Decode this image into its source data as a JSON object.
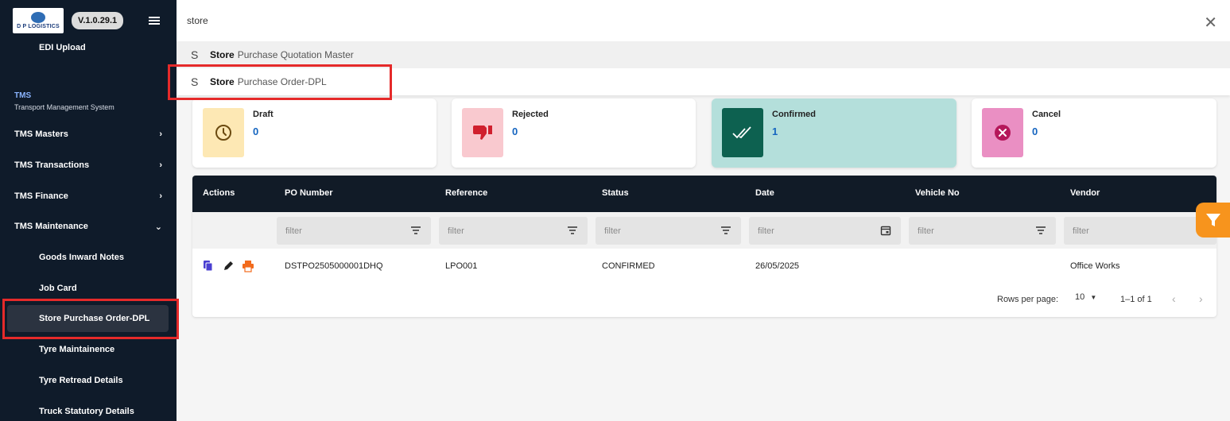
{
  "sidebar": {
    "logo_text": "D P LOGISTICS",
    "version": "V.1.0.29.1",
    "edi_upload": "EDI Upload",
    "section_title": "TMS",
    "section_subtitle": "Transport Management System",
    "items": [
      {
        "label": "TMS Masters",
        "chevron": "›"
      },
      {
        "label": "TMS Transactions",
        "chevron": "›"
      },
      {
        "label": "TMS Finance",
        "chevron": "›"
      },
      {
        "label": "TMS Maintenance",
        "chevron": "⌄"
      }
    ],
    "subitems": [
      {
        "label": "Goods Inward Notes"
      },
      {
        "label": "Job Card"
      },
      {
        "label": "Store Purchase Order-DPL",
        "active": true
      },
      {
        "label": "Tyre Maintainence"
      },
      {
        "label": "Tyre Retread Details"
      },
      {
        "label": "Truck Statutory Details"
      }
    ]
  },
  "search": {
    "value": "store",
    "close_icon": "✕",
    "results": [
      {
        "icon": "S",
        "highlight": "Store",
        "rest": "Purchase Quotation Master"
      },
      {
        "icon": "S",
        "highlight": "Store",
        "rest": "Purchase Order-DPL"
      }
    ]
  },
  "cards": [
    {
      "label": "Draft",
      "count": "0",
      "icon": "clock-icon",
      "icon_bg": "#fde8b4",
      "icon_color": "#b07a10"
    },
    {
      "label": "Rejected",
      "count": "0",
      "icon": "thumbs-down-icon",
      "icon_bg": "#f9c9cf",
      "icon_color": "#d0202e"
    },
    {
      "label": "Confirmed",
      "count": "1",
      "icon": "double-check-icon",
      "icon_bg": "#0d6150",
      "icon_color": "#ffffff"
    },
    {
      "label": "Cancel",
      "count": "0",
      "icon": "cancel-circle-icon",
      "icon_bg": "#ea8fc3",
      "icon_color": "#c2185b"
    }
  ],
  "table": {
    "columns": [
      "Actions",
      "PO Number",
      "Reference",
      "Status",
      "Date",
      "Vehicle No",
      "Vendor"
    ],
    "filter_placeholder": "filter",
    "rows": [
      {
        "po_number": "DSTPO2505000001DHQ",
        "reference": "LPO001",
        "status": "CONFIRMED",
        "date": "26/05/2025",
        "vehicle_no": "",
        "vendor": "Office Works"
      }
    ],
    "pagination": {
      "rows_per_page_label": "Rows per page:",
      "rows_per_page": "10",
      "range": "1–1 of 1",
      "prev": "‹",
      "next": "›"
    }
  },
  "colors": {
    "accent_orange": "#f7941d",
    "header_dark": "#111b27",
    "highlight_red": "#e52a2a",
    "count_blue": "#1565c0"
  }
}
